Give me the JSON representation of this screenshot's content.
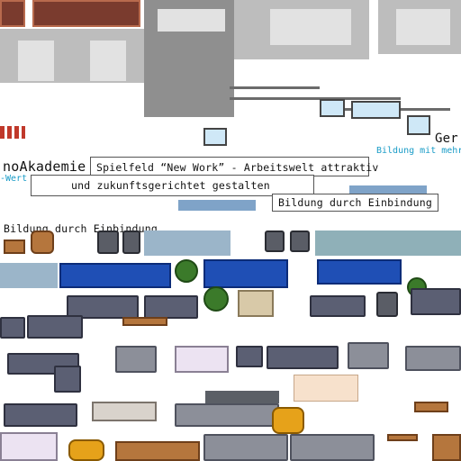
{
  "signs": {
    "main_line1": "Spielfeld “New Work” - Arbeitswelt attraktiv",
    "main_line2": "und zukunftsgerichtet gestalten",
    "akademie": "noAkademie",
    "bildung_einbindung": "Bildung durch Einbindung",
    "bildung_einbindung_left": "Bildung durch Einbindung",
    "ger": "Ger",
    "bildung_mehr": "Bildung mit mehr",
    "wert": "-Wert"
  },
  "colors": {
    "carpet": "#7a3b2e",
    "rug": "#1f4fb5",
    "sofa": "#5b5f73",
    "accent_text": "#1a9cc7"
  }
}
